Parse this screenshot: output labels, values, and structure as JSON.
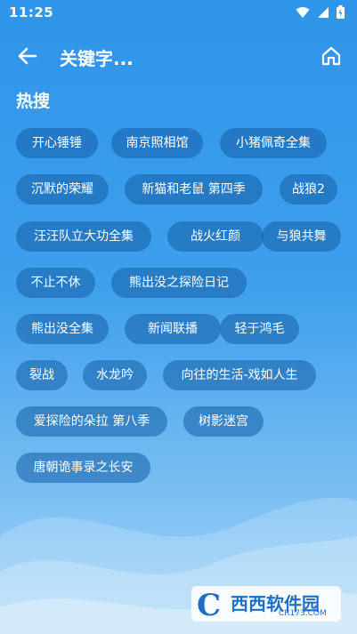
{
  "status_bar": {
    "time": "11:25"
  },
  "app_bar": {
    "title": "关键字..."
  },
  "section": {
    "title": "热搜"
  },
  "tags": [
    "开心锤锤",
    "南京照相馆",
    "小猪佩奇全集",
    "沉默的荣耀",
    "新猫和老鼠 第四季",
    "战狼2",
    "汪汪队立大功全集",
    "战火红颜",
    "与狼共舞",
    "不止不休",
    "熊出没之探险日记",
    "熊出没全集",
    "新闻联播",
    "轻于鸿毛",
    "裂战",
    "水龙吟",
    "向往的生活-戏如人生",
    "爱探险的朵拉 第八季",
    "树影迷宫",
    "唐朝诡事录之长安"
  ],
  "watermark": {
    "logo_text": "西西软件园",
    "url": "CR173.COM"
  }
}
